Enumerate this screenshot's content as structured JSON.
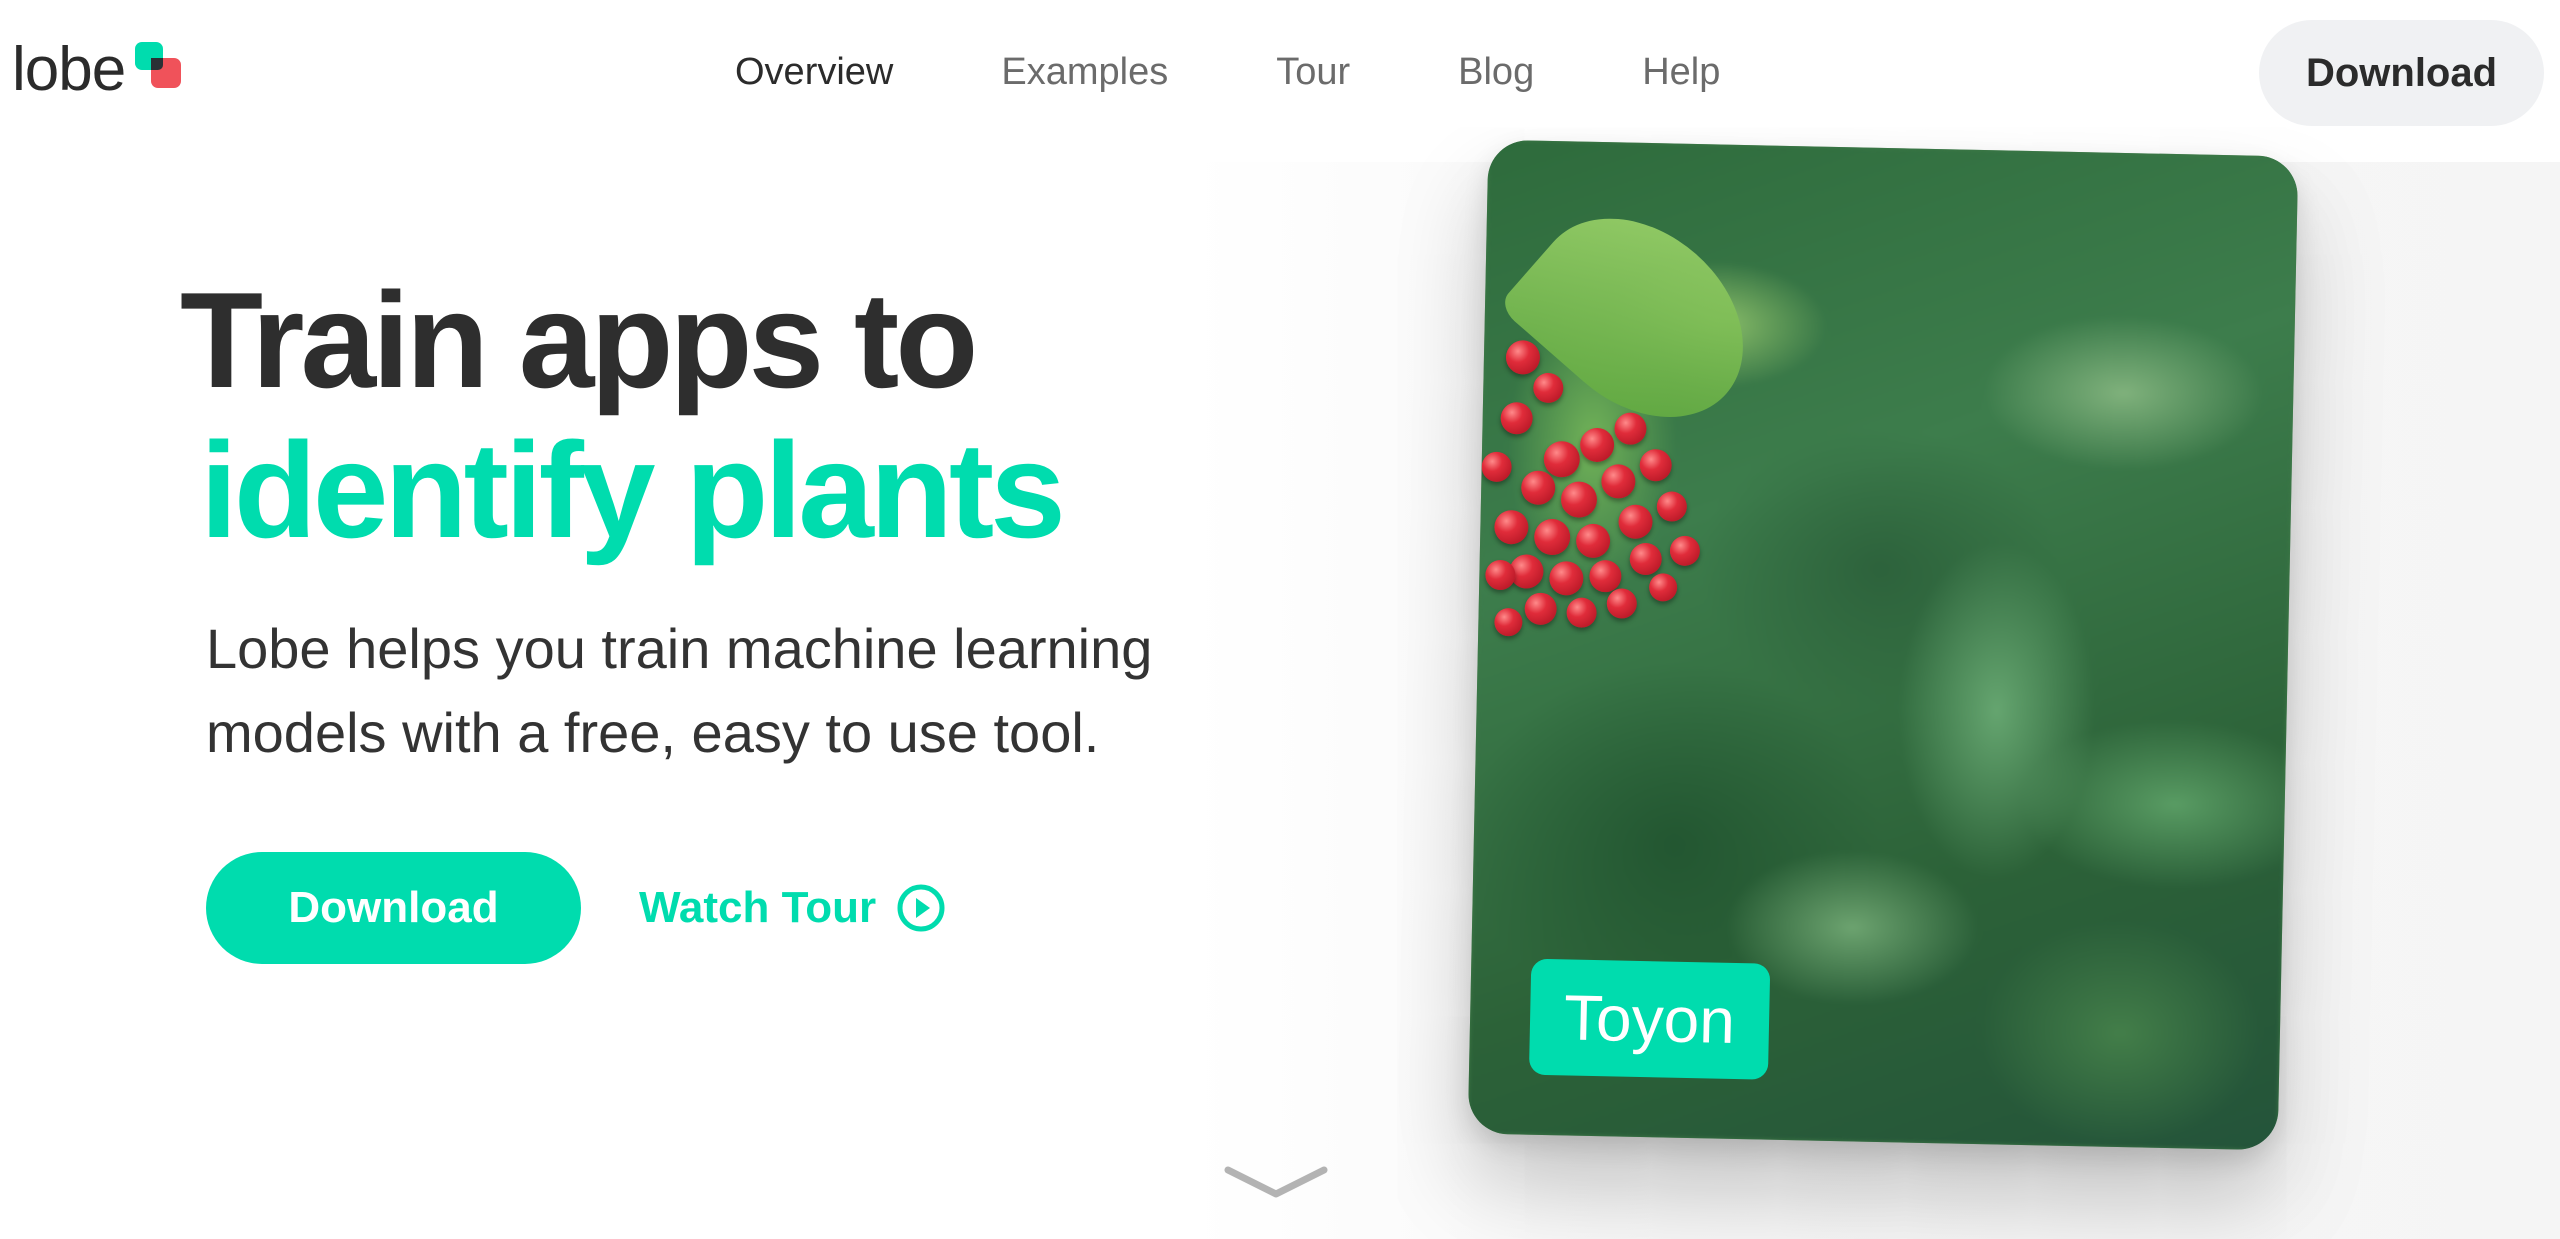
{
  "brand": {
    "logo_text": "lobe",
    "colors": {
      "accent": "#00DCAE",
      "logo_red": "#F0525A",
      "heading": "#2E2E2E",
      "nav_button_bg": "#F0F1F3"
    }
  },
  "nav": {
    "links": [
      {
        "label": "Overview",
        "active": true
      },
      {
        "label": "Examples",
        "active": false
      },
      {
        "label": "Tour",
        "active": false
      },
      {
        "label": "Blog",
        "active": false
      },
      {
        "label": "Help",
        "active": false
      }
    ],
    "download_label": "Download"
  },
  "hero": {
    "headline_line1": "Train apps to",
    "headline_line2": "identify plants",
    "subtitle": "Lobe helps you train machine learning models with a free, easy to use tool.",
    "download_label": "Download",
    "watch_tour_label": "Watch Tour",
    "watch_tour_icon": "play-circle-icon"
  },
  "visual": {
    "image_label": "Toyon",
    "scroll_icon": "chevron-down-icon"
  }
}
